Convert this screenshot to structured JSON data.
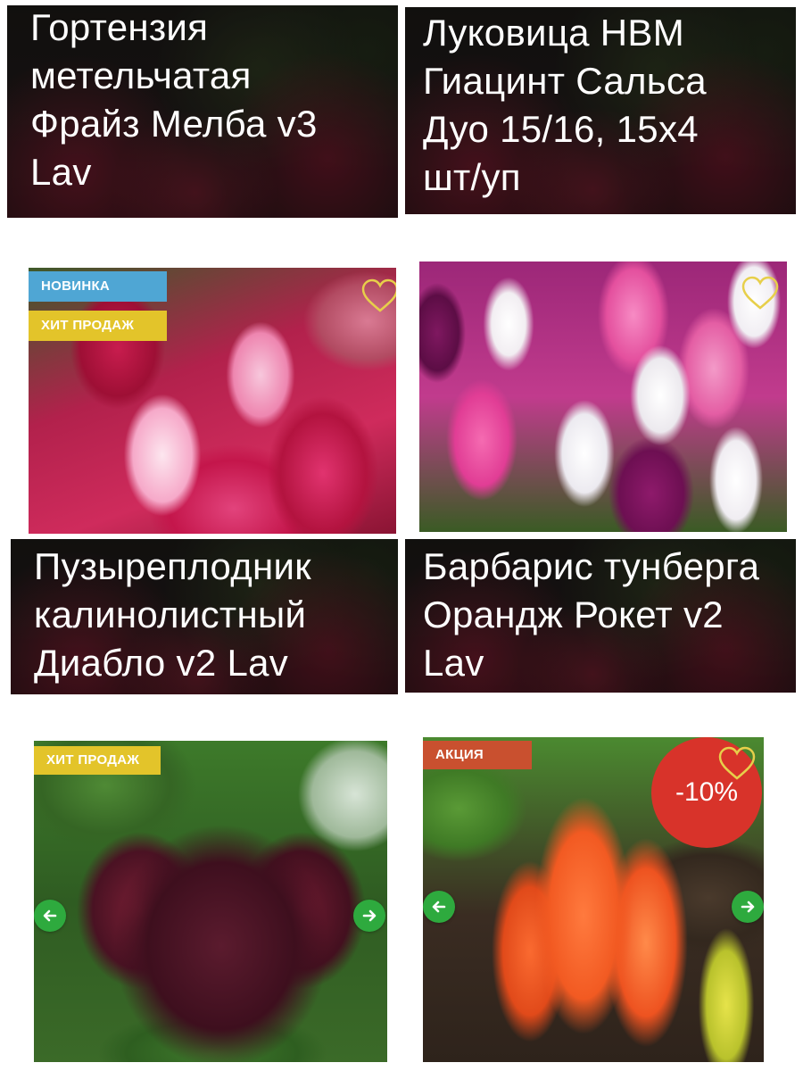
{
  "colors": {
    "badge_new": "#4fa6d4",
    "badge_hit": "#e3c42a",
    "badge_sale": "#c9502f",
    "discount_circle": "#d8332a",
    "carousel_arrow": "#2eaa3e",
    "heart_outline": "#e7cf4a"
  },
  "products": [
    {
      "title": "Гортензия\nметельчатая\nФрайз Мелба v3\nLav"
    },
    {
      "title": "Луковица НВМ\nГиацинт Сальса\nДуо 15/16, 15х4\nшт/уп"
    },
    {
      "title": "Пузыреплодник\nкалинолистный\nДиабло v2 Lav",
      "badges": [
        "НОВИНКА",
        "ХИТ ПРОДАЖ"
      ],
      "icon": "heart-icon"
    },
    {
      "title": "Барбарис тунберга\nОрандж Рокет v2\nLav",
      "icon": "heart-icon"
    },
    {
      "badges": [
        "ХИТ ПРОДАЖ"
      ],
      "icons": [
        "arrow-left-icon",
        "arrow-right-icon"
      ]
    },
    {
      "badges": [
        "АКЦИЯ"
      ],
      "discount": "-10%",
      "icons": [
        "heart-icon",
        "arrow-left-icon",
        "arrow-right-icon"
      ]
    }
  ]
}
